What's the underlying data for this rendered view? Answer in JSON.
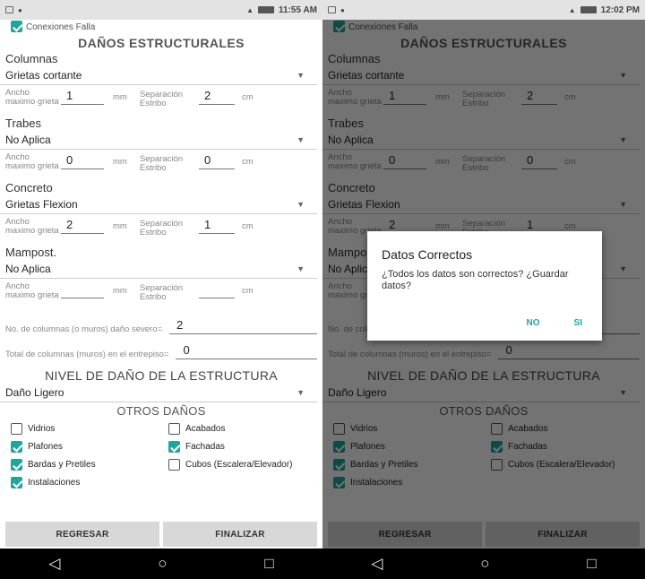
{
  "screens": [
    {
      "time": "11:55 AM"
    },
    {
      "time": "12:02 PM"
    }
  ],
  "form": {
    "top_checkbox_label": "Conexiones Falla",
    "title": "DAÑOS ESTRUCTURALES",
    "sections": [
      {
        "name": "Columnas",
        "dropdown": "Grietas cortante",
        "ancho_label": "Ancho maximo grieta",
        "ancho_value": "1",
        "ancho_unit": "mm",
        "sep_label": "Separación Estribo",
        "sep_value": "2",
        "sep_unit": "cm"
      },
      {
        "name": "Trabes",
        "dropdown": "No Aplica",
        "ancho_label": "Ancho maximo grieta",
        "ancho_value": "0",
        "ancho_unit": "mm",
        "sep_label": "Separación Estribo",
        "sep_value": "0",
        "sep_unit": "cm"
      },
      {
        "name": "Concreto",
        "dropdown": "Grietas Flexion",
        "ancho_label": "Ancho maximo grieta",
        "ancho_value": "2",
        "ancho_unit": "mm",
        "sep_label": "Separación Estribo",
        "sep_value": "1",
        "sep_unit": "cm"
      },
      {
        "name": "Mampost.",
        "dropdown": "No Aplica",
        "ancho_label": "Ancho maximo grieta",
        "ancho_value": "",
        "ancho_unit": "mm",
        "sep_label": "Separación Estribo",
        "sep_value": "",
        "sep_unit": "cm"
      }
    ],
    "severe_label": "No. de columnas (o muros) daño severo=",
    "severe_value": "2",
    "total_label": "Total de columnas (muros) en el entrepiso=",
    "total_value": "0",
    "nivel_title": "NIVEL DE DAÑO DE LA ESTRUCTURA",
    "nivel_value": "Daño Ligero",
    "otros_title": "OTROS DAÑOS",
    "checks": [
      {
        "label": "Vidrios",
        "checked": false
      },
      {
        "label": "Acabados",
        "checked": false
      },
      {
        "label": "Plafones",
        "checked": true
      },
      {
        "label": "Fachadas",
        "checked": true
      },
      {
        "label": "Bardas y Pretiles",
        "checked": true
      },
      {
        "label": "Cubos (Escalera/Elevador)",
        "checked": false
      },
      {
        "label": "Instalaciones",
        "checked": true
      }
    ],
    "btn_back": "REGRESAR",
    "btn_finish": "FINALIZAR"
  },
  "dialog": {
    "title": "Datos Correctos",
    "message": "¿Todos los datos son correctos? ¿Guardar datos?",
    "no": "NO",
    "yes": "SI"
  },
  "colors": {
    "accent": "#1fa69a",
    "button": "#d8d8d8"
  },
  "icons": {
    "back": "back-triangle-icon",
    "home": "home-circle-icon",
    "recents": "recents-square-icon",
    "dropdown": "dropdown-caret-icon"
  }
}
